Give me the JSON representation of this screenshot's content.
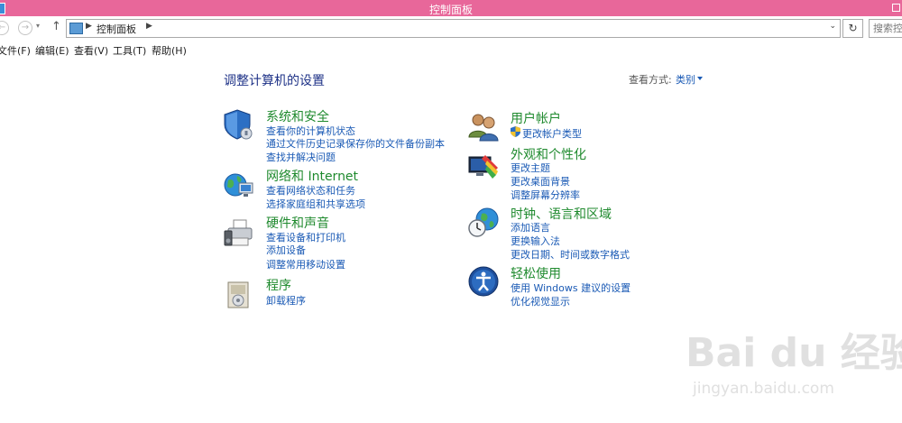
{
  "window": {
    "title": "控制面板"
  },
  "address": {
    "path": "控制面板",
    "search_placeholder": "搜索控制"
  },
  "menu": [
    "文件(F)",
    "编辑(E)",
    "查看(V)",
    "工具(T)",
    "帮助(H)"
  ],
  "page": {
    "heading": "调整计算机的设置",
    "view_by_label": "查看方式:",
    "view_by_value": "类别"
  },
  "categories": {
    "system_security": {
      "title": "系统和安全",
      "links": [
        "查看你的计算机状态",
        "通过文件历史记录保存你的文件备份副本",
        "查找并解决问题"
      ]
    },
    "network": {
      "title": "网络和 Internet",
      "links": [
        "查看网络状态和任务",
        "选择家庭组和共享选项"
      ]
    },
    "hardware": {
      "title": "硬件和声音",
      "links": [
        "查看设备和打印机",
        "添加设备",
        "调整常用移动设置"
      ]
    },
    "programs": {
      "title": "程序",
      "links": [
        "卸载程序"
      ]
    },
    "user_accounts": {
      "title": "用户帐户",
      "links": [
        "更改帐户类型"
      ]
    },
    "appearance": {
      "title": "外观和个性化",
      "links": [
        "更改主题",
        "更改桌面背景",
        "调整屏幕分辨率"
      ]
    },
    "clock_region": {
      "title": "时钟、语言和区域",
      "links": [
        "添加语言",
        "更换输入法",
        "更改日期、时间或数字格式"
      ]
    },
    "ease_of_access": {
      "title": "轻松使用",
      "links": [
        "使用 Windows 建议的设置",
        "优化视觉显示"
      ]
    }
  },
  "watermark": {
    "logo": "Bai du 经验",
    "url": "jingyan.baidu.com"
  }
}
